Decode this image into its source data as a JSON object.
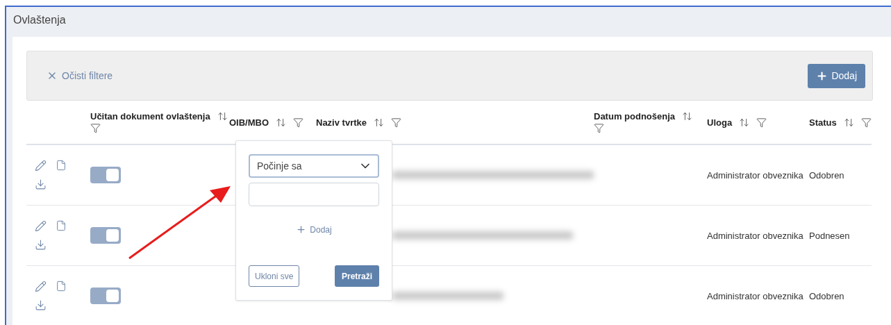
{
  "panel": {
    "title": "Ovlaštenja"
  },
  "toolbar": {
    "clear_filters": "Očisti filtere",
    "add_button": "Dodaj"
  },
  "table": {
    "columns": [
      "Učitan dokument ovlaštenja",
      "OIB/MBO",
      "Naziv tvrtke",
      "Datum podnošenja",
      "Uloga",
      "Status"
    ],
    "rows": [
      {
        "document_loaded": true,
        "role": "Administrator obveznika",
        "status": "Odobren"
      },
      {
        "document_loaded": true,
        "role": "Administrator obveznika",
        "status": "Podnesen"
      },
      {
        "document_loaded": true,
        "role": "Administrator obveznika",
        "status": "Odobren"
      }
    ]
  },
  "filter_popup": {
    "match_mode": "Počinje sa",
    "add_rule": "Dodaj",
    "clear_button": "Ukloni sve",
    "search_button": "Pretraži"
  }
}
